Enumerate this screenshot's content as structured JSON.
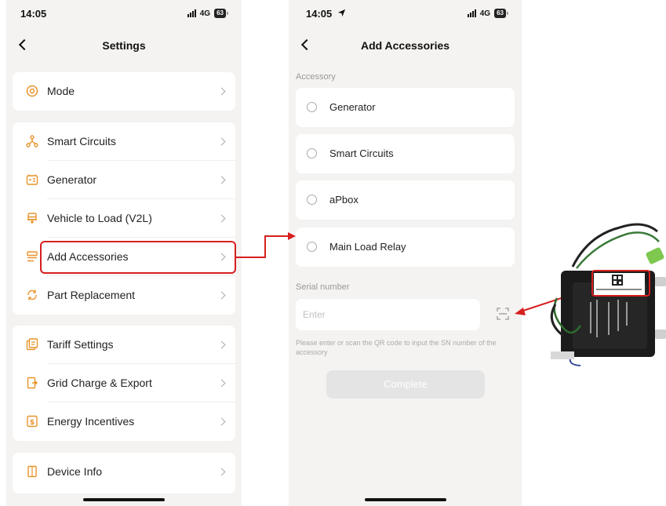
{
  "settings_screen": {
    "status": {
      "time": "14:05",
      "network": "4G",
      "battery": "63"
    },
    "nav": {
      "title": "Settings"
    },
    "groups": [
      {
        "items": [
          {
            "label": "Mode",
            "icon": "mode-icon"
          }
        ]
      },
      {
        "items": [
          {
            "label": "Smart Circuits",
            "icon": "smart-circuits-icon"
          },
          {
            "label": "Generator",
            "icon": "generator-icon"
          },
          {
            "label": "Vehicle to Load (V2L)",
            "icon": "vehicle-icon"
          },
          {
            "label": "Add Accessories",
            "icon": "accessories-icon"
          },
          {
            "label": "Part Replacement",
            "icon": "part-replacement-icon"
          }
        ]
      },
      {
        "items": [
          {
            "label": "Tariff Settings",
            "icon": "tariff-icon"
          },
          {
            "label": "Grid Charge & Export",
            "icon": "grid-charge-icon"
          },
          {
            "label": "Energy Incentives",
            "icon": "energy-incentives-icon"
          }
        ]
      },
      {
        "items": [
          {
            "label": "Device Info",
            "icon": "device-info-icon"
          }
        ]
      }
    ]
  },
  "accessories_screen": {
    "status": {
      "time": "14:05",
      "network": "4G",
      "battery": "63"
    },
    "nav": {
      "title": "Add Accessories"
    },
    "accessory_label": "Accessory",
    "options": [
      {
        "label": "Generator"
      },
      {
        "label": "Smart Circuits"
      },
      {
        "label": "aPbox"
      },
      {
        "label": "Main Load Relay"
      }
    ],
    "serial_label": "Serial number",
    "serial_input": {
      "value": "",
      "placeholder": "Enter"
    },
    "hint": "Please enter or scan the QR code to input the SN number of the accessory",
    "complete_label": "Complete"
  },
  "colors": {
    "accent": "#e8932c",
    "annotation": "#d61f1f",
    "background": "#f4f3f2"
  }
}
